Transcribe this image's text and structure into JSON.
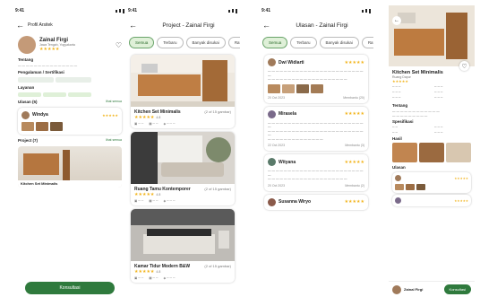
{
  "status": {
    "time": "9:41"
  },
  "profile": {
    "header": "Profil Arsitek",
    "name": "Zainal Firgi",
    "rating": "4.8",
    "location": "Jawa Tengah, Yogyakarta",
    "bio_title": "Tentang",
    "experience_title": "Pengalaman / Sertifikasi",
    "services_title": "Layanan",
    "reviews_title": "Ulasan (5)",
    "projects_title": "Project (7)",
    "see_all": "lihat semua",
    "reviewer": "Windya",
    "project_card": "Kitchen Set Minimalis",
    "cta": "Konsultasi"
  },
  "projects": {
    "title": "Project - Zainal Firgi",
    "chips": [
      "Semua",
      "Terbaru",
      "Banyak disukai",
      "Rating",
      "Lainnya"
    ],
    "items": [
      {
        "name": "Kitchen Set Minimalis",
        "count": "(2 of 15 gambar)",
        "rating": "4.8"
      },
      {
        "name": "Ruang Tamu Kontemporer",
        "count": "(2 of 15 gambar)",
        "rating": "4.8"
      },
      {
        "name": "Kamar Tidur Modern B&W",
        "count": "(2 of 15 gambar)",
        "rating": "4.8"
      }
    ]
  },
  "reviews": {
    "title": "Ulasan - Zainal Firgi",
    "chips": [
      "Semua",
      "Terbaru",
      "Banyak disukai",
      "Rating",
      "Lainnya"
    ],
    "items": [
      {
        "name": "Dwi Widiarti",
        "time": "20 Oct 2023",
        "likes": "Membantu (20)"
      },
      {
        "name": "Mirasela",
        "time": "22 Oct 2023",
        "likes": "Membantu (3)"
      },
      {
        "name": "Wityana",
        "time": "20 Oct 2023",
        "likes": "Membantu (2)"
      },
      {
        "name": "Susanna Wiryo",
        "time": "",
        "likes": ""
      }
    ]
  },
  "detail": {
    "title": "Kitchen Set Minimalis",
    "sub": "Ruang Dapur",
    "desc_title": "Tentang",
    "spec_title": "Spesifikasi",
    "gallery_title": "Hasil",
    "reviews_title": "Ulasan",
    "owner": "Zainal Firgi",
    "cta": "Konsultasi"
  }
}
